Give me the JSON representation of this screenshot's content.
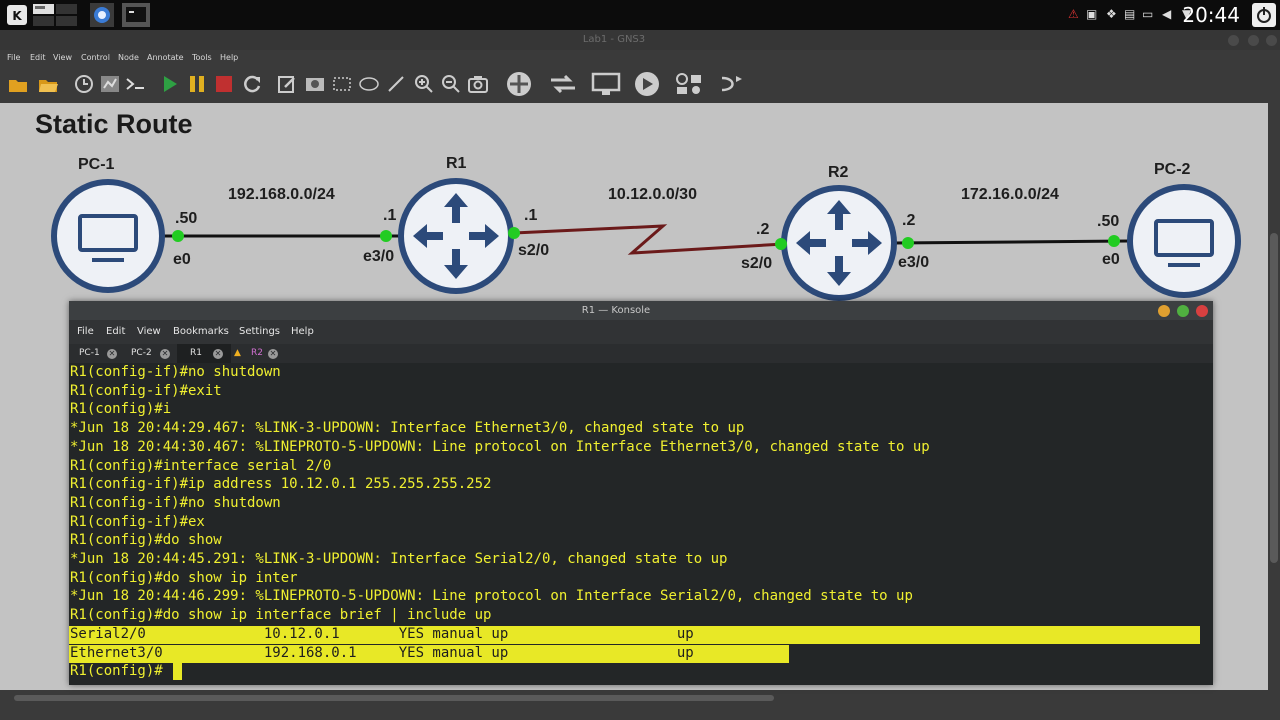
{
  "desktop": {
    "clock": "20:44",
    "tray_icons": [
      "muted-icon",
      "camera-icon",
      "dropbox-icon",
      "network-icon",
      "battery-icon",
      "volume-icon",
      "chevron-down-icon",
      "power-icon"
    ]
  },
  "gns3": {
    "window_title": "Lab1 - GNS3",
    "menu": [
      "File",
      "Edit",
      "View",
      "Control",
      "Node",
      "Annotate",
      "Tools",
      "Help"
    ],
    "toolbar": [
      "new-project-icon",
      "open-project-icon",
      "snapshot-icon",
      "capture-icon",
      "console-all-icon",
      "start-all-icon",
      "suspend-all-icon",
      "stop-all-icon",
      "reload-all-icon",
      "add-note-icon",
      "insert-picture-icon",
      "draw-rectangle-icon",
      "draw-ellipse-icon",
      "draw-line-icon",
      "zoom-in-icon",
      "zoom-out-icon",
      "screenshot-icon",
      "browse-routers-icon",
      "browse-switches-icon",
      "browse-end-devices-icon",
      "browse-security-icon",
      "browse-all-devices-icon",
      "add-link-icon"
    ]
  },
  "topology": {
    "title": "Static Route",
    "nodes": {
      "pc1": "PC-1",
      "r1": "R1",
      "r2": "R2",
      "pc2": "PC-2"
    },
    "networks": {
      "lan1": "192.168.0.0/24",
      "wan": "10.12.0.0/30",
      "lan2": "172.16.0.0/24"
    },
    "labels": {
      "pc1_host": ".50",
      "pc1_if": "e0",
      "r1_e_host": ".1",
      "r1_e_if": "e3/0",
      "r1_s_host": ".1",
      "r1_s_if": "s2/0",
      "r2_s_host": ".2",
      "r2_s_if": "s2/0",
      "r2_e_host": ".2",
      "r2_e_if": "e3/0",
      "pc2_host": ".50",
      "pc2_if": "e0"
    },
    "colors": {
      "node_border": "#2c4a7a",
      "port_up": "#22cc22",
      "serial_link": "#6b1a1a",
      "ethernet_link": "#111111"
    }
  },
  "konsole": {
    "title": "R1 — Konsole",
    "menu": [
      "File",
      "Edit",
      "View",
      "Bookmarks",
      "Settings",
      "Help"
    ],
    "tabs": [
      {
        "label": "PC-1",
        "active": false
      },
      {
        "label": "PC-2",
        "active": false
      },
      {
        "label": "R1",
        "active": true
      },
      {
        "label": "R2",
        "active": false,
        "bell": true
      }
    ],
    "lines": [
      "R1(config-if)#no shutdown",
      "R1(config-if)#exit",
      "R1(config)#i",
      "*Jun 18 20:44:29.467: %LINK-3-UPDOWN: Interface Ethernet3/0, changed state to up",
      "*Jun 18 20:44:30.467: %LINEPROTO-5-UPDOWN: Line protocol on Interface Ethernet3/0, changed state to up",
      "R1(config)#interface serial 2/0",
      "R1(config-if)#ip address 10.12.0.1 255.255.255.252",
      "R1(config-if)#no shutdown",
      "R1(config-if)#ex",
      "R1(config)#do show",
      "*Jun 18 20:44:45.291: %LINK-3-UPDOWN: Interface Serial2/0, changed state to up",
      "R1(config)#do show ip inter",
      "*Jun 18 20:44:46.299: %LINEPROTO-5-UPDOWN: Line protocol on Interface Serial2/0, changed state to up",
      "R1(config)#do show ip interface brief | include up",
      "Serial2/0              10.12.0.1       YES manual up                    up",
      "Ethernet3/0            192.168.0.1     YES manual up                    up",
      "R1(config)#"
    ],
    "colors": {
      "text": "#f0f030",
      "background": "#232627",
      "highlight": "#e8e826"
    }
  }
}
